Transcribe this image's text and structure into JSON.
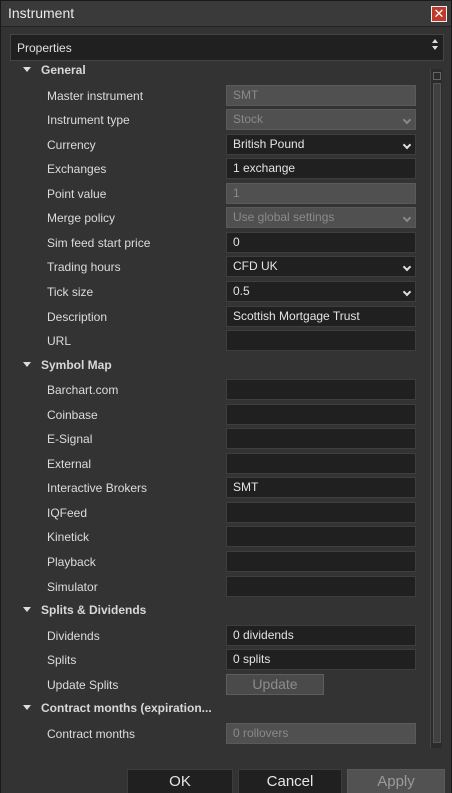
{
  "window": {
    "title": "Instrument"
  },
  "properties_header": "Properties",
  "rows": [
    {
      "kind": "category",
      "label": "General"
    },
    {
      "kind": "prop",
      "label": "Master instrument",
      "value": "SMT",
      "disabled": true
    },
    {
      "kind": "prop",
      "label": "Instrument type",
      "value": "Stock",
      "disabled": true,
      "dropdown": true
    },
    {
      "kind": "prop",
      "label": "Currency",
      "value": "British Pound",
      "dropdown": true
    },
    {
      "kind": "prop",
      "label": "Exchanges",
      "value": "1 exchange"
    },
    {
      "kind": "prop",
      "label": "Point value",
      "value": "1",
      "disabled": true
    },
    {
      "kind": "prop",
      "label": "Merge policy",
      "value": "Use global settings",
      "disabled": true,
      "dropdown": true
    },
    {
      "kind": "prop",
      "label": "Sim feed start price",
      "value": "0"
    },
    {
      "kind": "prop",
      "label": "Trading hours",
      "value": "CFD UK",
      "dropdown": true
    },
    {
      "kind": "prop",
      "label": "Tick size",
      "value": "0.5",
      "dropdown": true
    },
    {
      "kind": "prop",
      "label": "Description",
      "value": "Scottish Mortgage Trust"
    },
    {
      "kind": "prop",
      "label": "URL",
      "value": ""
    },
    {
      "kind": "category",
      "label": "Symbol Map"
    },
    {
      "kind": "prop",
      "label": "Barchart.com",
      "value": ""
    },
    {
      "kind": "prop",
      "label": "Coinbase",
      "value": ""
    },
    {
      "kind": "prop",
      "label": "E-Signal",
      "value": ""
    },
    {
      "kind": "prop",
      "label": "External",
      "value": ""
    },
    {
      "kind": "prop",
      "label": "Interactive Brokers",
      "value": "SMT"
    },
    {
      "kind": "prop",
      "label": "IQFeed",
      "value": ""
    },
    {
      "kind": "prop",
      "label": "Kinetick",
      "value": ""
    },
    {
      "kind": "prop",
      "label": "Playback",
      "value": ""
    },
    {
      "kind": "prop",
      "label": "Simulator",
      "value": ""
    },
    {
      "kind": "category",
      "label": "Splits & Dividends"
    },
    {
      "kind": "prop",
      "label": "Dividends",
      "value": "0 dividends"
    },
    {
      "kind": "prop",
      "label": "Splits",
      "value": "0 splits"
    },
    {
      "kind": "button",
      "label": "Update Splits",
      "value": "Update"
    },
    {
      "kind": "category",
      "label": "Contract months (expiration..."
    },
    {
      "kind": "prop",
      "label": "Contract months",
      "value": "0 rollovers",
      "disabled": true
    }
  ],
  "footer": {
    "ok": "OK",
    "cancel": "Cancel",
    "apply": "Apply"
  }
}
